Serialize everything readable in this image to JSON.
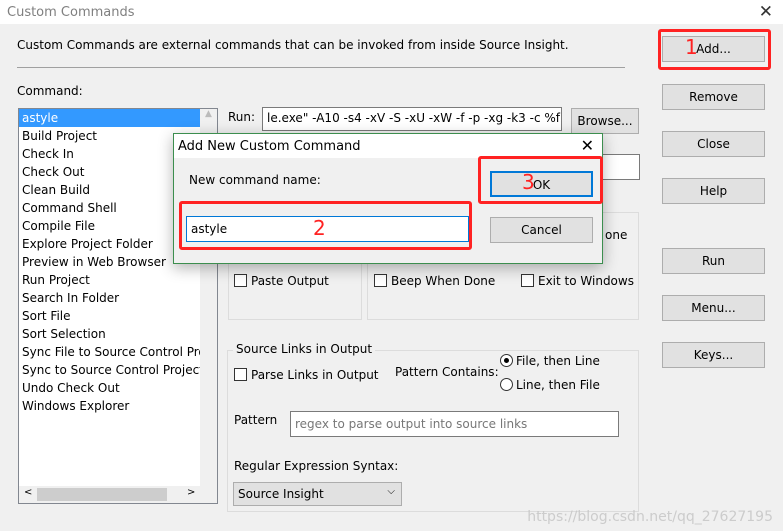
{
  "window": {
    "title": "Custom Commands",
    "description": "Custom Commands are external commands that can be invoked from inside Source Insight.",
    "command_label": "Command:",
    "run_label": "Run:",
    "run_value": "le.exe\" -A10 -s4 -xV -S -xU -xW -f -p -xg -k3 -c %f",
    "browse": "Browse..."
  },
  "commands": [
    "astyle",
    "Build Project",
    "Check In",
    "Check Out",
    "Clean Build",
    "Command Shell",
    "Compile File",
    "Explore Project Folder",
    "Preview in Web Browser",
    "Run Project",
    "Search In Folder",
    "Sort File",
    "Sort Selection",
    "Sync File to Source Control Pro",
    "Sync to Source Control Project",
    "Undo Check Out",
    "Windows Explorer"
  ],
  "buttons": {
    "add": "Add...",
    "remove": "Remove",
    "close": "Close",
    "help": "Help",
    "run": "Run",
    "menu": "Menu...",
    "keys": "Keys..."
  },
  "output": {
    "partial_right": "one",
    "paste_output": "Paste Output",
    "beep": "Beep When Done",
    "exit": "Exit to Windows"
  },
  "source_links": {
    "title": "Source Links in Output",
    "parse": "Parse Links in Output",
    "pattern_contains": "Pattern Contains:",
    "opt1": "File, then Line",
    "opt2": "Line, then File",
    "pattern_label": "Pattern",
    "pattern_placeholder": "regex to parse output into source links",
    "regex_label": "Regular Expression Syntax:",
    "regex_value": "Source Insight"
  },
  "dialog": {
    "title": "Add New Custom Command",
    "label": "New command name:",
    "value": "astyle",
    "ok": "OK",
    "cancel": "Cancel"
  },
  "annotations": [
    "1",
    "2",
    "3"
  ],
  "watermark": "https://blog.csdn.net/qq_27627195",
  "colors": {
    "selection": "#3399ff",
    "annotation": "#ff2222",
    "focus": "#0078d7"
  }
}
